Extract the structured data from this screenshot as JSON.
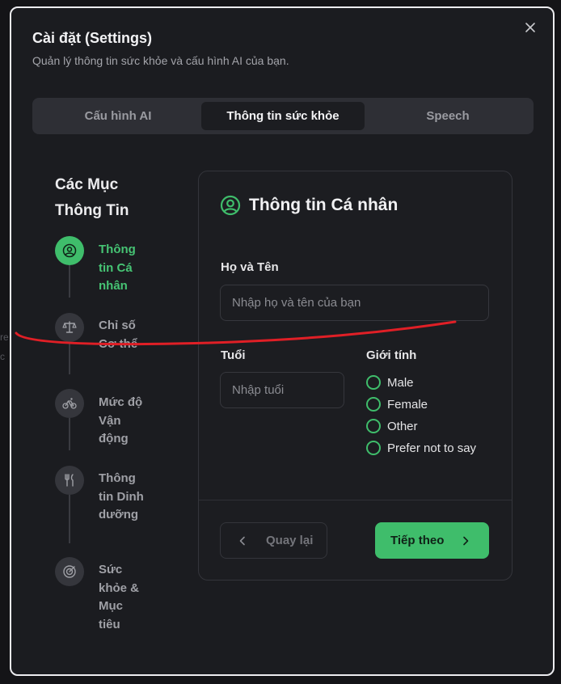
{
  "background": {
    "fragments": [
      "re",
      "c"
    ]
  },
  "dialog": {
    "title": "Cài đặt (Settings)",
    "subtitle": "Quản lý thông tin sức khỏe và cấu hình AI của bạn.",
    "close_icon": "close-icon"
  },
  "tabs": [
    {
      "label": "Cấu hình AI",
      "active": false
    },
    {
      "label": "Thông tin sức khỏe",
      "active": true
    },
    {
      "label": "Speech",
      "active": false
    }
  ],
  "steps": {
    "title": "Các Mục Thông Tin",
    "items": [
      {
        "label": "Thông tin Cá nhân",
        "icon": "user-circle-icon",
        "active": true
      },
      {
        "label": "Chỉ số Cơ thể",
        "icon": "scale-icon",
        "active": false
      },
      {
        "label": "Mức độ Vận động",
        "icon": "bicycle-icon",
        "active": false
      },
      {
        "label": "Thông tin Dinh dưỡng",
        "icon": "utensils-icon",
        "active": false
      },
      {
        "label": "Sức khỏe & Mục tiêu",
        "icon": "target-icon",
        "active": false
      }
    ]
  },
  "form": {
    "title": "Thông tin Cá nhân",
    "title_icon": "user-circle-icon",
    "name": {
      "label": "Họ và Tên",
      "value": "",
      "placeholder": "Nhập họ và tên của bạn"
    },
    "age": {
      "label": "Tuổi",
      "value": "",
      "placeholder": "Nhập tuổi"
    },
    "gender": {
      "label": "Giới tính",
      "options": [
        "Male",
        "Female",
        "Other",
        "Prefer not to say"
      ],
      "selected": null
    },
    "back_label": "Quay lại",
    "next_label": "Tiếp theo"
  },
  "colors": {
    "accent": "#3fbd6b",
    "dialog_bg": "#1b1c20",
    "annotation_stroke": "#e01f26"
  }
}
